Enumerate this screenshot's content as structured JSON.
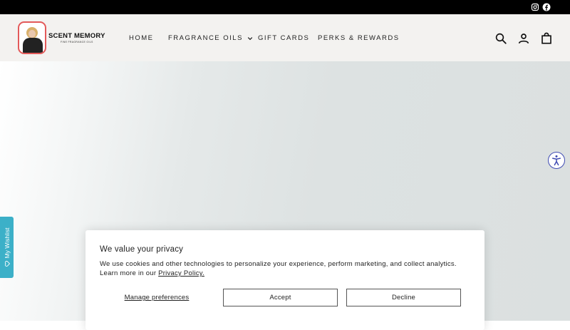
{
  "topbar": {
    "social": [
      {
        "icon": "instagram-icon"
      },
      {
        "icon": "facebook-icon"
      }
    ]
  },
  "brand": {
    "name": "SCENT MEMORY",
    "tagline": "FINE FRAGRANCE OILS"
  },
  "nav": {
    "items": [
      {
        "label": "HOME"
      },
      {
        "label": "FRAGRANCE OILS",
        "has_dropdown": true
      },
      {
        "label": "GIFT CARDS"
      },
      {
        "label": "PERKS & REWARDS"
      }
    ]
  },
  "header_icons": [
    "search-icon",
    "account-icon",
    "cart-icon"
  ],
  "wishlist": {
    "label": "My Wishlist",
    "icon": "heart-icon"
  },
  "accessibility": {
    "icon": "accessibility-icon"
  },
  "cookie_banner": {
    "title": "We value your privacy",
    "text": "We use cookies and other technologies to personalize your experience, perform marketing, and collect analytics. Learn more in our ",
    "link_label": "Privacy Policy.",
    "manage_label": "Manage preferences",
    "accept_label": "Accept",
    "decline_label": "Decline"
  },
  "colors": {
    "topbar": "#000000",
    "header_bg": "#f3f2f0",
    "wishlist_tab": "#3cb0c8",
    "accessibility_accent": "#3f4bb3"
  }
}
